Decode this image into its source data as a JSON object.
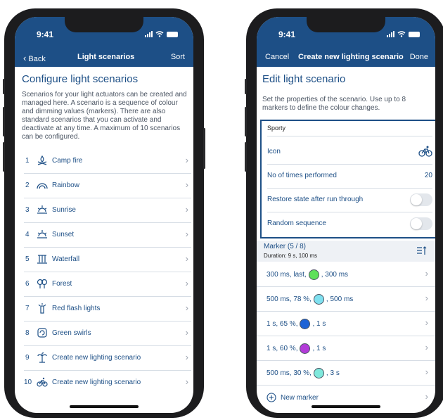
{
  "left": {
    "status": {
      "time": "9:41"
    },
    "nav": {
      "back": "Back",
      "title": "Light scenarios",
      "action": "Sort"
    },
    "heading": "Configure light scenarios",
    "description": "Scenarios for your light actuators can be created and managed here. A scenario is a sequence of colour and dimming values (markers). There are also standard scenarios that you can activate and deactivate at any time. A maximum of 10 scenarios can be configured.",
    "items": [
      {
        "num": "1",
        "label": "Camp fire",
        "icon": "campfire-icon"
      },
      {
        "num": "2",
        "label": "Rainbow",
        "icon": "rainbow-icon"
      },
      {
        "num": "3",
        "label": "Sunrise",
        "icon": "sunrise-icon"
      },
      {
        "num": "4",
        "label": "Sunset",
        "icon": "sunset-icon"
      },
      {
        "num": "5",
        "label": "Waterfall",
        "icon": "waterfall-icon"
      },
      {
        "num": "6",
        "label": "Forest",
        "icon": "forest-icon"
      },
      {
        "num": "7",
        "label": "Red flash lights",
        "icon": "flash-lights-icon"
      },
      {
        "num": "8",
        "label": "Green swirls",
        "icon": "swirl-icon"
      },
      {
        "num": "9",
        "label": "Create new lighting scenario",
        "icon": "palm-tree-icon"
      },
      {
        "num": "10",
        "label": "Create new lighting scenario",
        "icon": "bicycle-icon"
      }
    ]
  },
  "right": {
    "status": {
      "time": "9:41"
    },
    "nav": {
      "cancel": "Cancel",
      "title": "Create new lighting scenario",
      "done": "Done"
    },
    "heading": "Edit light scenario",
    "description": "Set the properties of the scenario. Use up to 8 markers to define the colour changes.",
    "name_value": "Sporty",
    "properties": {
      "icon_label": "Icon",
      "icon": "bicycle-icon",
      "times_label": "No of times performed",
      "times_value": "20",
      "restore_label": "Restore state after run through",
      "restore_on": false,
      "random_label": "Random sequence",
      "random_on": false
    },
    "marker_header": {
      "title": "Marker (5 / 8)",
      "duration": "Duration: 9 s, 100 ms"
    },
    "markers": [
      {
        "pre": "300 ms, last,",
        "color": "#5ee05a",
        "post": ", 300 ms"
      },
      {
        "pre": "500 ms, 78 %,",
        "color": "#7fe0ef",
        "post": ", 500 ms"
      },
      {
        "pre": "1 s, 65 %,",
        "color": "#1e63d6",
        "post": ", 1 s"
      },
      {
        "pre": "1 s, 60 %,",
        "color": "#b23bd8",
        "post": ", 1 s"
      },
      {
        "pre": "500 ms, 30 %,",
        "color": "#7fe8dc",
        "post": ", 3 s"
      }
    ],
    "new_marker": "New marker"
  },
  "colors": {
    "brand": "#1d4f86",
    "divider": "#d6dde5",
    "marker_bg": "#eef1f5"
  }
}
